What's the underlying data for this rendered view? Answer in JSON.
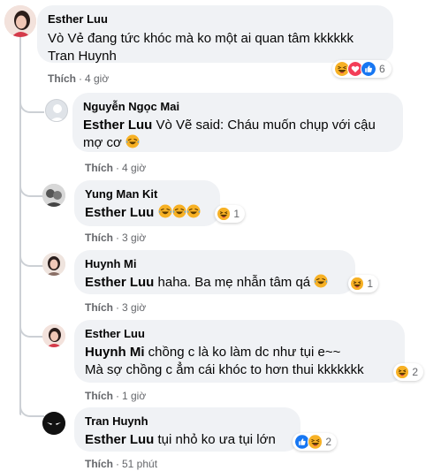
{
  "colors": {
    "bubble": "#f0f2f5",
    "meta": "#65676b",
    "like_blue": "#1877f2",
    "love_red": "#f33e58",
    "haha_yellow": "#f7b125"
  },
  "comments": [
    {
      "author": "Esther Luu",
      "text": "Vò Vẻ đang tức khóc mà ko một ai quan tâm kkkkkk Tran Huynh",
      "like": "Thích",
      "time": "4 giờ",
      "reaction_count": "6",
      "reactions": [
        "haha-icon",
        "love-icon",
        "like-icon"
      ]
    }
  ],
  "replies": [
    {
      "author": "Nguyễn Ngọc Mai",
      "tag": "Esther Luu",
      "text": " Vò Vẽ said: Cháu muốn chụp với cậu mợ cơ",
      "emoji": [
        "laughing-crying-icon"
      ],
      "like": "Thích",
      "time": "4 giờ"
    },
    {
      "author": "Yung Man Kit",
      "tag": "Esther Luu",
      "text": "",
      "emoji": [
        "laughing-crying-icon",
        "laughing-crying-icon",
        "laughing-crying-icon"
      ],
      "like": "Thích",
      "time": "3 giờ",
      "reaction_count": "1",
      "reactions": [
        "haha-icon"
      ]
    },
    {
      "author": "Huynh Mi",
      "tag": "Esther Luu",
      "text": " haha. Ba mẹ nhẫn tâm qá",
      "emoji": [
        "laughing-crying-icon"
      ],
      "like": "Thích",
      "time": "3 giờ",
      "reaction_count": "1",
      "reactions": [
        "haha-icon"
      ]
    },
    {
      "author": "Esther Luu",
      "tag": "Huynh Mi",
      "text": " chồng c là ko làm dc như tụi e~~",
      "text2": "Mà sợ chồng c ẳm cái khóc to hơn thui kkkkkkk",
      "like": "Thích",
      "time": "1 giờ",
      "reaction_count": "2",
      "reactions": [
        "haha-icon"
      ]
    },
    {
      "author": "Tran Huynh",
      "tag": "Esther Luu",
      "text": " tụi nhỏ ko ưa tụi lớn",
      "like": "Thích",
      "time": "51 phút",
      "reaction_count": "2",
      "reactions": [
        "like-icon",
        "haha-icon"
      ]
    }
  ],
  "sep": "·"
}
